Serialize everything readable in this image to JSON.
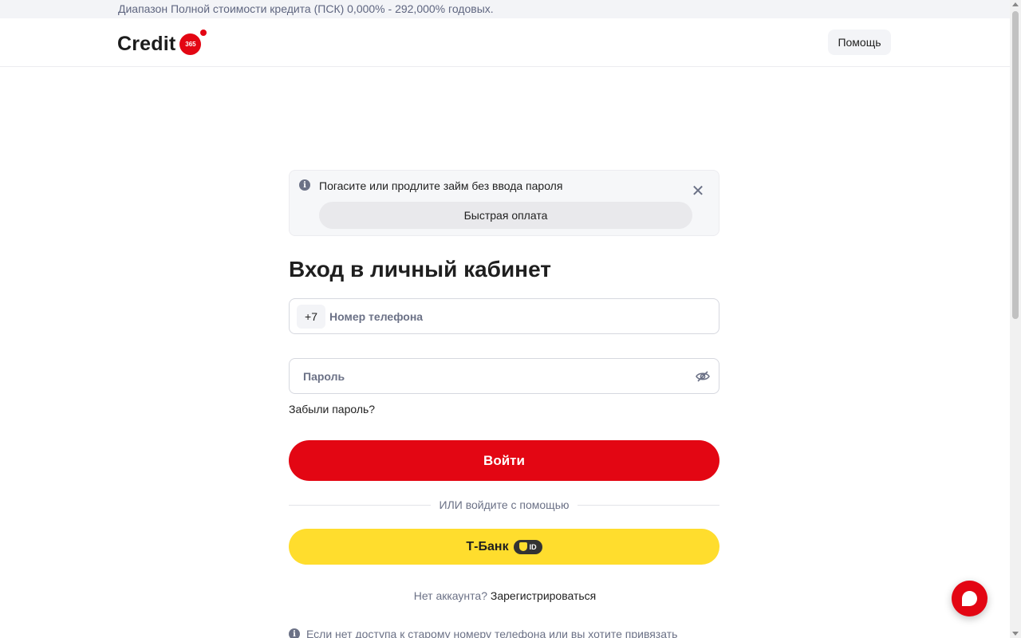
{
  "top_strip": {
    "text": "Диапазон Полной стоимости кредита (ПСК) 0,000% - 292,000% годовых."
  },
  "header": {
    "logo_text": "Credit",
    "logo_badge": "365",
    "help_label": "Помощь"
  },
  "notice": {
    "text": "Погасите или продлите займ без ввода пароля",
    "quick_pay_label": "Быстрая оплата",
    "close_symbol": "✕"
  },
  "login": {
    "title": "Вход в личный кабинет",
    "phone_prefix": "+7",
    "phone_placeholder": "Номер телефона",
    "phone_value": "",
    "password_placeholder": "Пароль",
    "password_value": "",
    "forgot_label": "Забыли пароль?",
    "submit_label": "Войти",
    "divider_text": "ИЛИ войдите с помощью",
    "tbank_label": "Т-Банк",
    "tbank_id_text": "ID",
    "no_account_text": "Нет аккаунта?",
    "register_label": "Зарегистрироваться",
    "bottom_note": "Если нет доступа к старому номеру телефона или вы хотите привязать"
  },
  "icons": {
    "info": "info-icon",
    "close": "close-icon",
    "eye": "eye-off-icon",
    "chat": "chat-icon"
  },
  "colors": {
    "brand_red": "#e30613",
    "tbank_yellow": "#ffdd2d",
    "muted_text": "#6b7186"
  }
}
